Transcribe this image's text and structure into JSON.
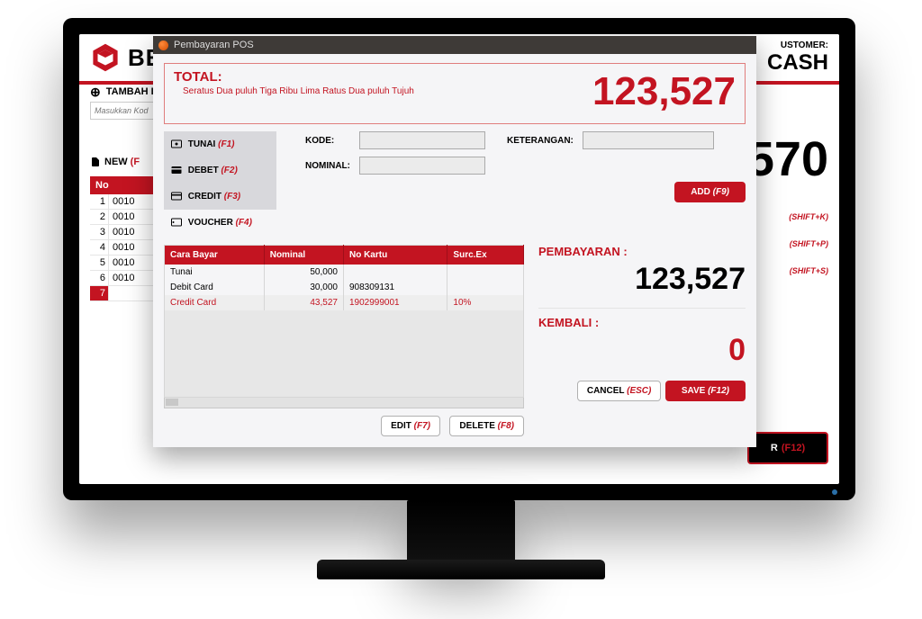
{
  "window": {
    "title": "Pembayaran POS"
  },
  "bg": {
    "logo_prefix": "BE",
    "customer_label": "USTOMER:",
    "customer_value": "CASH",
    "tambah_label": "TAMBAH I",
    "code_placeholder": "Masukkan Kod",
    "new_label": "NEW",
    "new_fk": "(F",
    "no_header": "No",
    "rows": [
      {
        "idx": "1",
        "v": "0010"
      },
      {
        "idx": "2",
        "v": "0010"
      },
      {
        "idx": "3",
        "v": "0010"
      },
      {
        "idx": "4",
        "v": "0010"
      },
      {
        "idx": "5",
        "v": "0010"
      },
      {
        "idx": "6",
        "v": "0010"
      },
      {
        "idx": "7",
        "v": ""
      }
    ],
    "big_total_suffix": "570",
    "shortcut_k": "(SHIFT+K)",
    "shortcut_p": "(SHIFT+P)",
    "shortcut_s": "(SHIFT+S)",
    "bayar_label": "R",
    "bayar_fk": "(F12)"
  },
  "total": {
    "label": "TOTAL:",
    "words": "Seratus Dua puluh Tiga Ribu Lima Ratus Dua puluh Tujuh",
    "amount": "123,527"
  },
  "tabs": {
    "tunai": "TUNAI",
    "tunai_fk": "(F1)",
    "debet": "DEBET",
    "debet_fk": "(F2)",
    "credit": "CREDIT",
    "credit_fk": "(F3)",
    "voucher": "VOUCHER",
    "voucher_fk": "(F4)"
  },
  "fields": {
    "kode_label": "KODE:",
    "ket_label": "KETERANGAN:",
    "nominal_label": "NOMINAL:",
    "add_label": "ADD",
    "add_fk": "(F9)"
  },
  "payments": {
    "headers": {
      "method": "Cara Bayar",
      "nominal": "Nominal",
      "card": "No Kartu",
      "surc": "Surc.Ex"
    },
    "rows": [
      {
        "method": "Tunai",
        "nominal": "50,000",
        "card": "",
        "surc": ""
      },
      {
        "method": "Debit Card",
        "nominal": "30,000",
        "card": "908309131",
        "surc": ""
      },
      {
        "method": "Credit Card",
        "nominal": "43,527",
        "card": "1902999001",
        "surc": "10%"
      }
    ],
    "selected_row_index": 2,
    "edit_label": "EDIT",
    "edit_fk": "(F7)",
    "delete_label": "DELETE",
    "delete_fk": "(F8)"
  },
  "summary": {
    "paid_label": "PEMBAYARAN :",
    "paid_value": "123,527",
    "change_label": "KEMBALI :",
    "change_value": "0",
    "cancel_label": "CANCEL",
    "cancel_fk": "(ESC)",
    "save_label": "SAVE",
    "save_fk": "(F12)"
  }
}
